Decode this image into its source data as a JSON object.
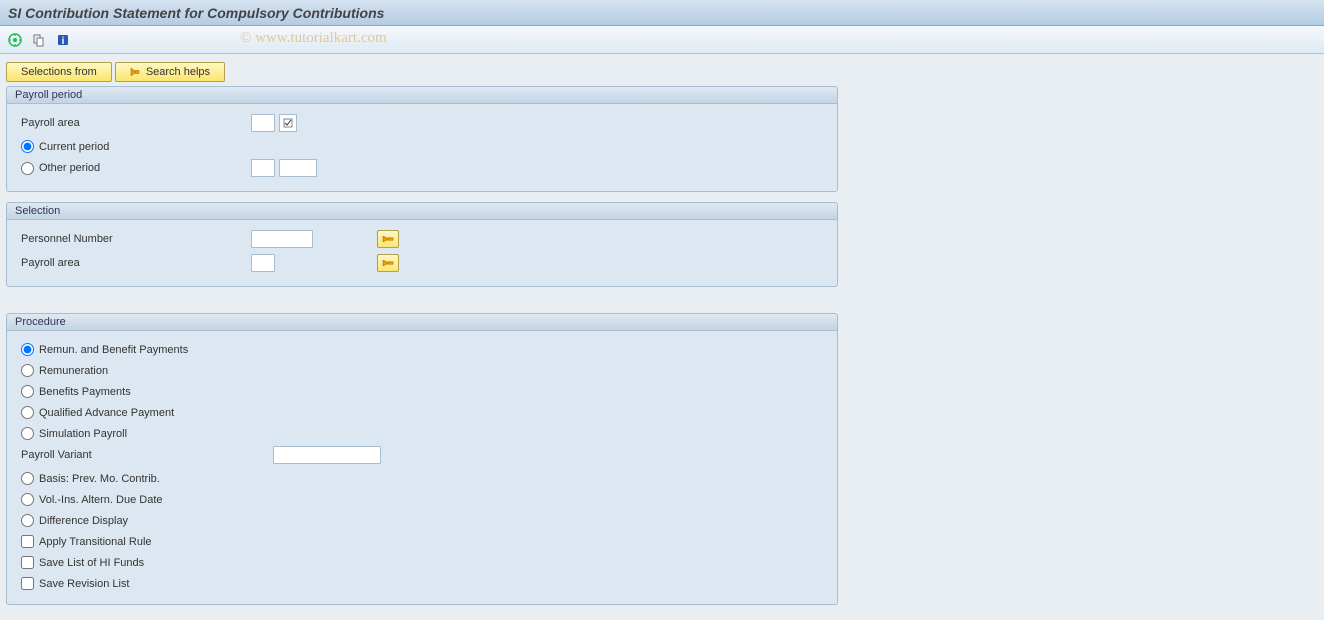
{
  "title": "SI Contribution Statement for Compulsory Contributions",
  "watermark": "© www.tutorialkart.com",
  "buttons": {
    "selections_from": "Selections from",
    "search_helps": "Search helps"
  },
  "payroll_period": {
    "header": "Payroll period",
    "payroll_area_label": "Payroll area",
    "payroll_area_value": "",
    "current_period_label": "Current period",
    "other_period_label": "Other period",
    "other_period_val1": "",
    "other_period_val2": ""
  },
  "selection": {
    "header": "Selection",
    "personnel_number_label": "Personnel Number",
    "personnel_number_value": "",
    "payroll_area_label": "Payroll area",
    "payroll_area_value": ""
  },
  "procedure": {
    "header": "Procedure",
    "remun_benefit_label": "Remun. and Benefit Payments",
    "remuneration_label": "Remuneration",
    "benefits_payments_label": "Benefits Payments",
    "qualified_advance_label": "Qualified Advance Payment",
    "simulation_payroll_label": "Simulation Payroll",
    "payroll_variant_label": "Payroll Variant",
    "payroll_variant_value": "",
    "basis_prev_mo_label": "Basis: Prev. Mo. Contrib.",
    "vol_ins_label": "Vol.-Ins. Altern. Due Date",
    "difference_display_label": "Difference Display",
    "apply_transitional_label": "Apply Transitional Rule",
    "save_hi_funds_label": "Save List of HI Funds",
    "save_revision_label": "Save Revision List"
  }
}
